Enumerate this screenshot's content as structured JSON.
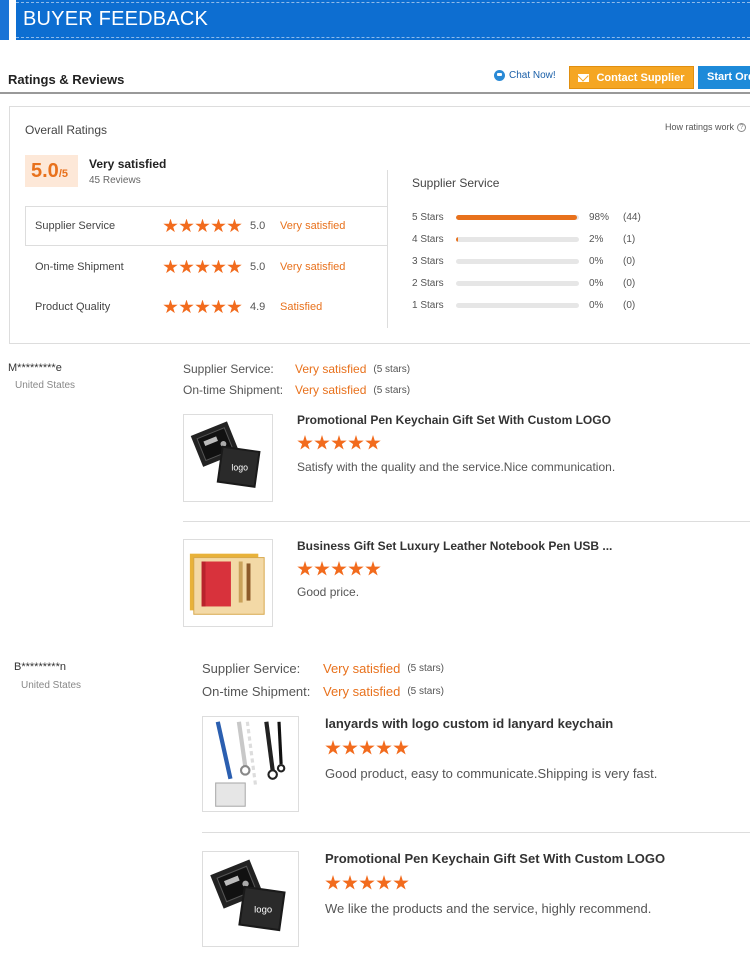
{
  "banner": {
    "title": "BUYER FEEDBACK"
  },
  "header": {
    "title": "Ratings & Reviews",
    "chat_label": "Chat Now!",
    "contact_label": "Contact Supplier",
    "start_label": "Start Order"
  },
  "overall": {
    "label": "Overall Ratings",
    "how_label": "How ratings work",
    "score": "5.0",
    "score_max": "/5",
    "verdict": "Very satisfied",
    "reviews": "45 Reviews",
    "criteria": [
      {
        "name": "Supplier Service",
        "stars": 5,
        "value": "5.0",
        "verdict": "Very satisfied"
      },
      {
        "name": "On-time Shipment",
        "stars": 5,
        "value": "5.0",
        "verdict": "Very satisfied"
      },
      {
        "name": "Product Quality",
        "stars": 5,
        "value": "4.9",
        "verdict": "Satisfied"
      }
    ]
  },
  "supplier_service": {
    "label": "Supplier Service",
    "rows": [
      {
        "label": "5 Stars",
        "percent": 98,
        "pct_text": "98%",
        "count": "(44)"
      },
      {
        "label": "4 Stars",
        "percent": 2,
        "pct_text": "2%",
        "count": "(1)"
      },
      {
        "label": "3 Stars",
        "percent": 0,
        "pct_text": "0%",
        "count": "(0)"
      },
      {
        "label": "2 Stars",
        "percent": 0,
        "pct_text": "0%",
        "count": "(0)"
      },
      {
        "label": "1 Stars",
        "percent": 0,
        "pct_text": "0%",
        "count": "(0)"
      }
    ]
  },
  "reviews": [
    {
      "buyer": "M*********e",
      "country": "United States",
      "service_label": "Supplier Service:",
      "service_value": "Very satisfied",
      "service_stars": "(5 stars)",
      "shipment_label": "On-time Shipment:",
      "shipment_value": "Very satisfied",
      "shipment_stars": "(5 stars)",
      "products": [
        {
          "title": "Promotional Pen Keychain Gift Set With Custom LOGO",
          "stars": 5,
          "comment": "Satisfy with the quality and the service.Nice communication.",
          "image": "black-gift-box",
          "logo_text": "logo"
        },
        {
          "title": "Business Gift Set Luxury Leather Notebook Pen USB ...",
          "stars": 5,
          "comment": "Good price.",
          "image": "red-notebook-set"
        }
      ]
    },
    {
      "buyer": "B*********n",
      "country": "United States",
      "service_label": "Supplier Service:",
      "service_value": "Very satisfied",
      "service_stars": "(5 stars)",
      "shipment_label": "On-time Shipment:",
      "shipment_value": "Very satisfied",
      "shipment_stars": "(5 stars)",
      "products": [
        {
          "title": "lanyards with logo custom id lanyard keychain",
          "stars": 5,
          "comment": "Good product, easy to communicate.Shipping is very fast.",
          "image": "lanyards"
        },
        {
          "title": "Promotional Pen Keychain Gift Set With Custom LOGO",
          "stars": 5,
          "comment": "We like the products and the service, highly recommend.",
          "image": "black-gift-box",
          "logo_text": "logo"
        }
      ]
    }
  ],
  "colors": {
    "accent": "#e8711c",
    "banner": "#0d6ed1",
    "contact": "#f5a623",
    "start": "#1d8ad9"
  }
}
